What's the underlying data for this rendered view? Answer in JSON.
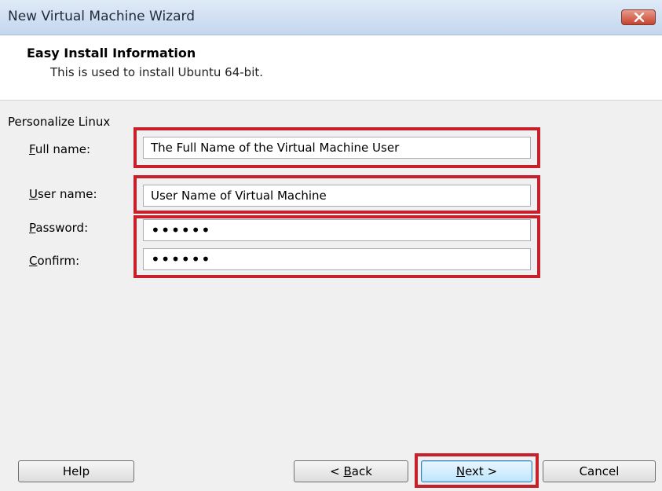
{
  "window": {
    "title": "New Virtual Machine Wizard",
    "close_icon": "close-icon"
  },
  "header": {
    "title": "Easy Install Information",
    "subtitle": "This is used to install Ubuntu 64-bit."
  },
  "form": {
    "group_label": "Personalize Linux",
    "full_name": {
      "label_accel": "F",
      "label_rest": "ull name:",
      "value": "The Full Name of the Virtual Machine User"
    },
    "user_name": {
      "label_accel": "U",
      "label_rest": "ser name:",
      "value": "User Name of Virtual Machine"
    },
    "password": {
      "label_accel": "P",
      "label_rest": "assword:",
      "value": "••••••"
    },
    "confirm": {
      "label_accel": "C",
      "label_rest": "onfirm:",
      "value": "••••••"
    }
  },
  "buttons": {
    "help": {
      "label": "Help"
    },
    "back": {
      "pre": "< ",
      "accel": "B",
      "rest": "ack"
    },
    "next": {
      "accel": "N",
      "rest": "ext >"
    },
    "cancel": {
      "label": "Cancel"
    }
  },
  "colors": {
    "highlight": "#c8202a",
    "titlebar": "#c4d6ee",
    "close": "#c8422e"
  }
}
